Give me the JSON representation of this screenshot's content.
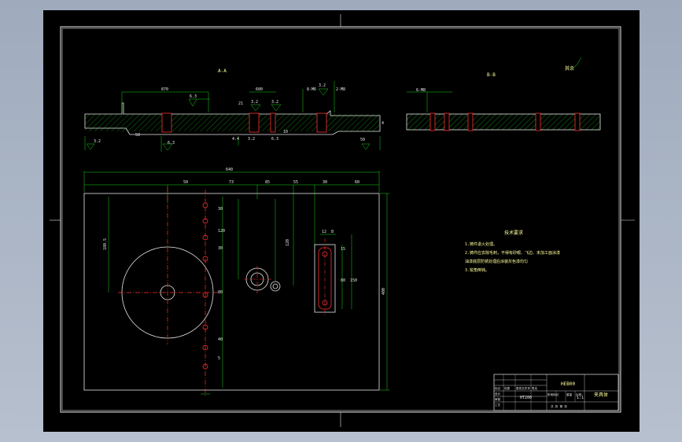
{
  "drawing": {
    "section_label_left": "A-A",
    "section_label_right": "B-B",
    "roughness_note": "其余",
    "top_dims": [
      "870",
      "600",
      "21",
      "3.2",
      "3.2",
      "8-M6",
      "2-M8",
      "3.2",
      "6.3"
    ],
    "top_dims_lower": [
      "3.2",
      "50",
      "6.3",
      "4.4",
      "3.2",
      "6.3",
      "10",
      "50",
      "4"
    ],
    "right_section_dim": "6-M8",
    "plan_width_dim": "640",
    "plan_top_dims": [
      "50",
      "73",
      "85",
      "55",
      "30",
      "60"
    ],
    "plan_side_dims_left": [
      "180.5",
      "30",
      "120",
      "30",
      "80",
      "40",
      "5"
    ],
    "plan_mid_dims": [
      "30",
      "60",
      "40",
      "120",
      "33",
      "150",
      "120",
      "80"
    ],
    "plan_height_dim": "400",
    "slot_dims": [
      "12",
      "8",
      "15",
      "80",
      "150"
    ],
    "tech_title": "技术要求",
    "tech_notes": [
      "1.铸件退火处理。",
      "2.铸件应去除毛刺，不得有砂眼、飞边、未加工面涂漆",
      "油漆底层防锈处理后涂装灰色漆均匀",
      "3.锐角倒钝。"
    ],
    "title_block": {
      "drawing_no": "HEB00",
      "part_name": "夹具体",
      "scale": "1:1",
      "material": "HT200",
      "row_labels": [
        "标记",
        "处数",
        "分区",
        "更改文件号",
        "签名",
        "年月日"
      ],
      "row_labels2": [
        "设计",
        "审核",
        "工艺",
        "批准"
      ],
      "stage_labels": [
        "阶段标记",
        "重量",
        "比例"
      ],
      "sheet": "共 张 第 张"
    }
  }
}
